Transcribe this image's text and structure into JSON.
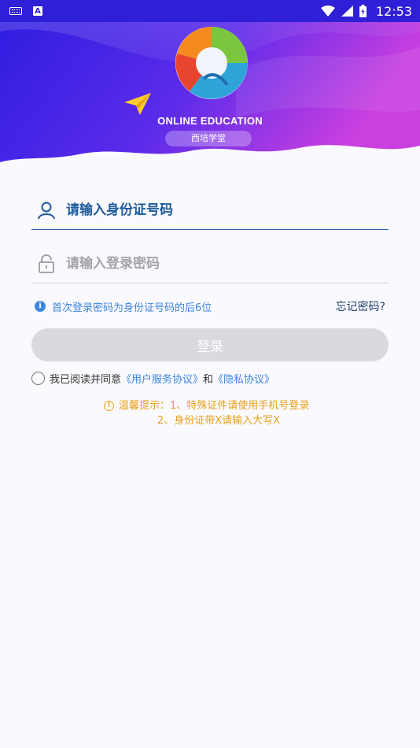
{
  "status_bar": {
    "time": "12:53",
    "left_icons": [
      "keyboard-icon",
      "a-icon"
    ],
    "right_icons": [
      "wifi-icon",
      "signal-icon",
      "battery-icon"
    ]
  },
  "header": {
    "brand_title": "ONLINE EDUCATION",
    "brand_subtitle": "西培学堂",
    "logo_icon": "globe-logo-icon",
    "plane_icon": "paper-plane-icon",
    "colors": {
      "gradient_start": "#2d1de0",
      "gradient_mid": "#5b2bea",
      "gradient_end": "#c93fe0"
    }
  },
  "form": {
    "id_placeholder": "请输入身份证号码",
    "password_placeholder": "请输入登录密码",
    "hint": "首次登录密码为身份证号码的后6位",
    "forgot": "忘记密码?",
    "login_button": "登录",
    "agree_prefix": "我已阅读并同意",
    "agree_link1": "《用户服务协议》",
    "agree_and": "和",
    "agree_link2": "《隐私协议》"
  },
  "tips": {
    "line1": "温馨提示：1、特殊证件请使用手机号登录",
    "line2": "2、身份证带X请输入大写X"
  }
}
